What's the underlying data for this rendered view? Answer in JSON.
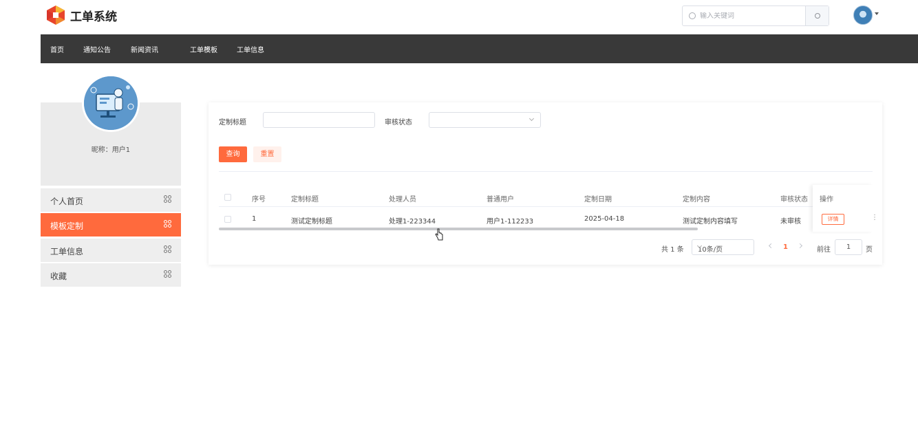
{
  "header": {
    "app_title": "工单系统",
    "search_placeholder": "输入关键词"
  },
  "nav": {
    "items": [
      "首页",
      "通知公告",
      "新闻资讯",
      "工单模板",
      "工单信息"
    ]
  },
  "sidebar": {
    "nickname": "昵称：用户1",
    "items": [
      "个人首页",
      "模板定制",
      "工单信息",
      "收藏"
    ],
    "active_index": 1
  },
  "filters": {
    "title_label": "定制标题",
    "title_value": "",
    "status_label": "审核状态",
    "status_value": "",
    "query_label": "查询",
    "reset_label": "重置"
  },
  "table": {
    "headers": [
      "序号",
      "定制标题",
      "处理人员",
      "普通用户",
      "定制日期",
      "定制内容",
      "审核状态",
      "操作"
    ],
    "rows": [
      [
        "1",
        "测试定制标题",
        "处理1-223344",
        "用户1-112233",
        "2025-04-18",
        "测试定制内容填写",
        "未审核"
      ]
    ],
    "detail_label": "详情"
  },
  "pagination": {
    "total": "共 1 条",
    "page_size": "10条/页",
    "current_page": "1",
    "goto_label": "前往",
    "goto_value": "1",
    "page_suffix": "页"
  },
  "colors": {
    "accent": "#ff6a3d",
    "nav_bg": "#393939"
  }
}
